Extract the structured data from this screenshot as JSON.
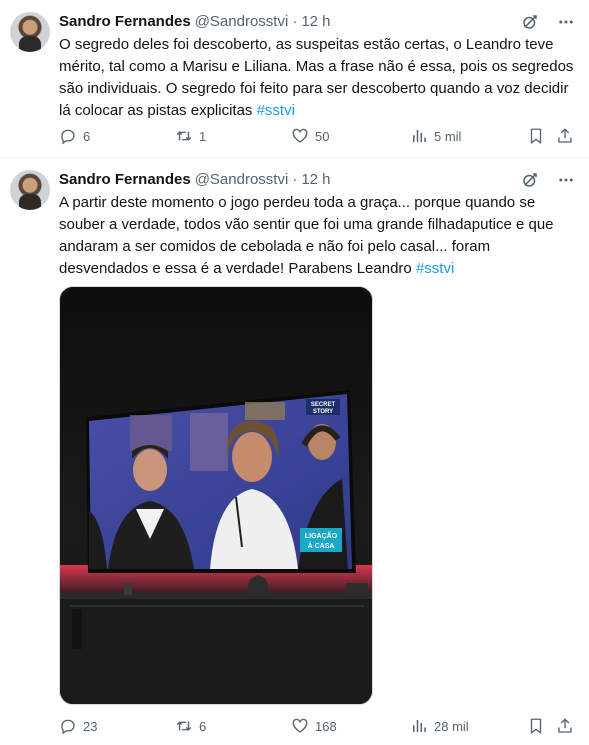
{
  "tweets": [
    {
      "author_name": "Sandro Fernandes",
      "handle": "@Sandrosstvi",
      "separator": "·",
      "time": "12 h",
      "text": "O segredo deles foi descoberto, as suspeitas estão certas, o Leandro teve mérito, tal como a Marisu e Liliana. Mas a frase não é essa, pois os segredos são individuais. O segredo foi feito para ser descoberto quando a voz decidir lá colocar as pistas explicitas ",
      "hashtag": "#sstvi",
      "replies": "6",
      "reposts": "1",
      "likes": "50",
      "views": "5 mil"
    },
    {
      "author_name": "Sandro Fernandes",
      "handle": "@Sandrosstvi",
      "separator": "·",
      "time": "12 h",
      "text": "A partir deste momento o jogo perdeu toda a graça... porque quando se souber a verdade, todos vão sentir que foi uma grande filhadaputice e que andaram a ser comidos de cebolada e não foi pelo casal... foram desvendados e essa é a verdade! Parabens Leandro ",
      "hashtag": "#sstvi",
      "replies": "23",
      "reposts": "6",
      "likes": "168",
      "views": "28 mil",
      "media": {
        "tv_logo_text": [
          "SECRET",
          "STORY"
        ],
        "tv_caption": [
          "LIGAÇÃO",
          "À CASA"
        ]
      }
    }
  ],
  "colors": {
    "text": "#0f1419",
    "secondary": "#536471",
    "link": "#1d9bf0",
    "border": "#eff3f4"
  },
  "icons": [
    "grok-icon",
    "more-icon",
    "reply-icon",
    "repost-icon",
    "like-icon",
    "views-icon",
    "bookmark-icon",
    "share-icon"
  ]
}
